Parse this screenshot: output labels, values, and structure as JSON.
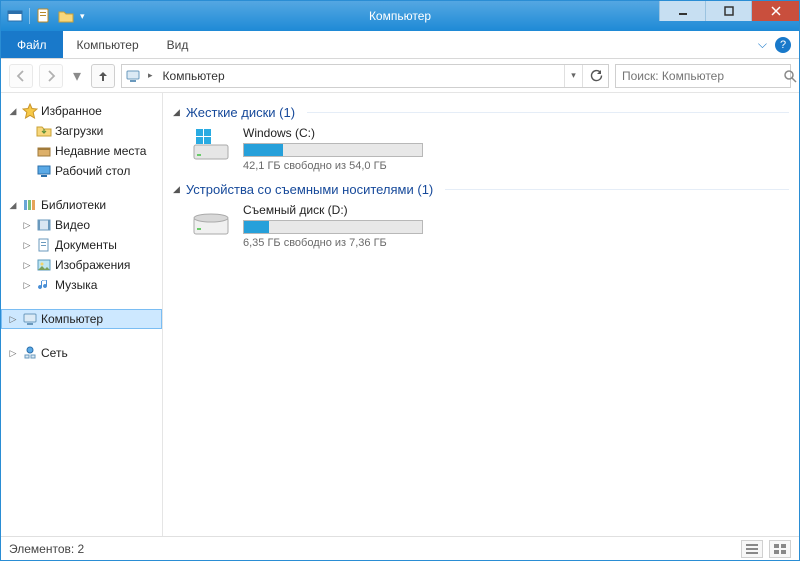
{
  "window": {
    "title": "Компьютер"
  },
  "ribbon": {
    "file": "Файл",
    "tabs": [
      "Компьютер",
      "Вид"
    ]
  },
  "breadcrumb": {
    "root": "Компьютер"
  },
  "search": {
    "placeholder": "Поиск: Компьютер"
  },
  "sidebar": {
    "favorites": {
      "label": "Избранное",
      "items": [
        {
          "label": "Загрузки",
          "icon": "download-folder-icon"
        },
        {
          "label": "Недавние места",
          "icon": "recent-places-icon"
        },
        {
          "label": "Рабочий стол",
          "icon": "desktop-icon"
        }
      ]
    },
    "libraries": {
      "label": "Библиотеки",
      "items": [
        {
          "label": "Видео",
          "icon": "video-library-icon"
        },
        {
          "label": "Документы",
          "icon": "documents-library-icon"
        },
        {
          "label": "Изображения",
          "icon": "pictures-library-icon"
        },
        {
          "label": "Музыка",
          "icon": "music-library-icon"
        }
      ]
    },
    "computer": {
      "label": "Компьютер"
    },
    "network": {
      "label": "Сеть"
    }
  },
  "groups": [
    {
      "title": "Жесткие диски (1)",
      "drives": [
        {
          "name": "Windows (C:)",
          "free_text": "42,1 ГБ свободно из 54,0 ГБ",
          "used_pct": 22,
          "icon": "hdd-windows-icon"
        }
      ]
    },
    {
      "title": "Устройства со съемными носителями (1)",
      "drives": [
        {
          "name": "Съемный диск (D:)",
          "free_text": "6,35 ГБ свободно из 7,36 ГБ",
          "used_pct": 14,
          "icon": "removable-disk-icon"
        }
      ]
    }
  ],
  "status": {
    "items_text": "Элементов: 2"
  }
}
